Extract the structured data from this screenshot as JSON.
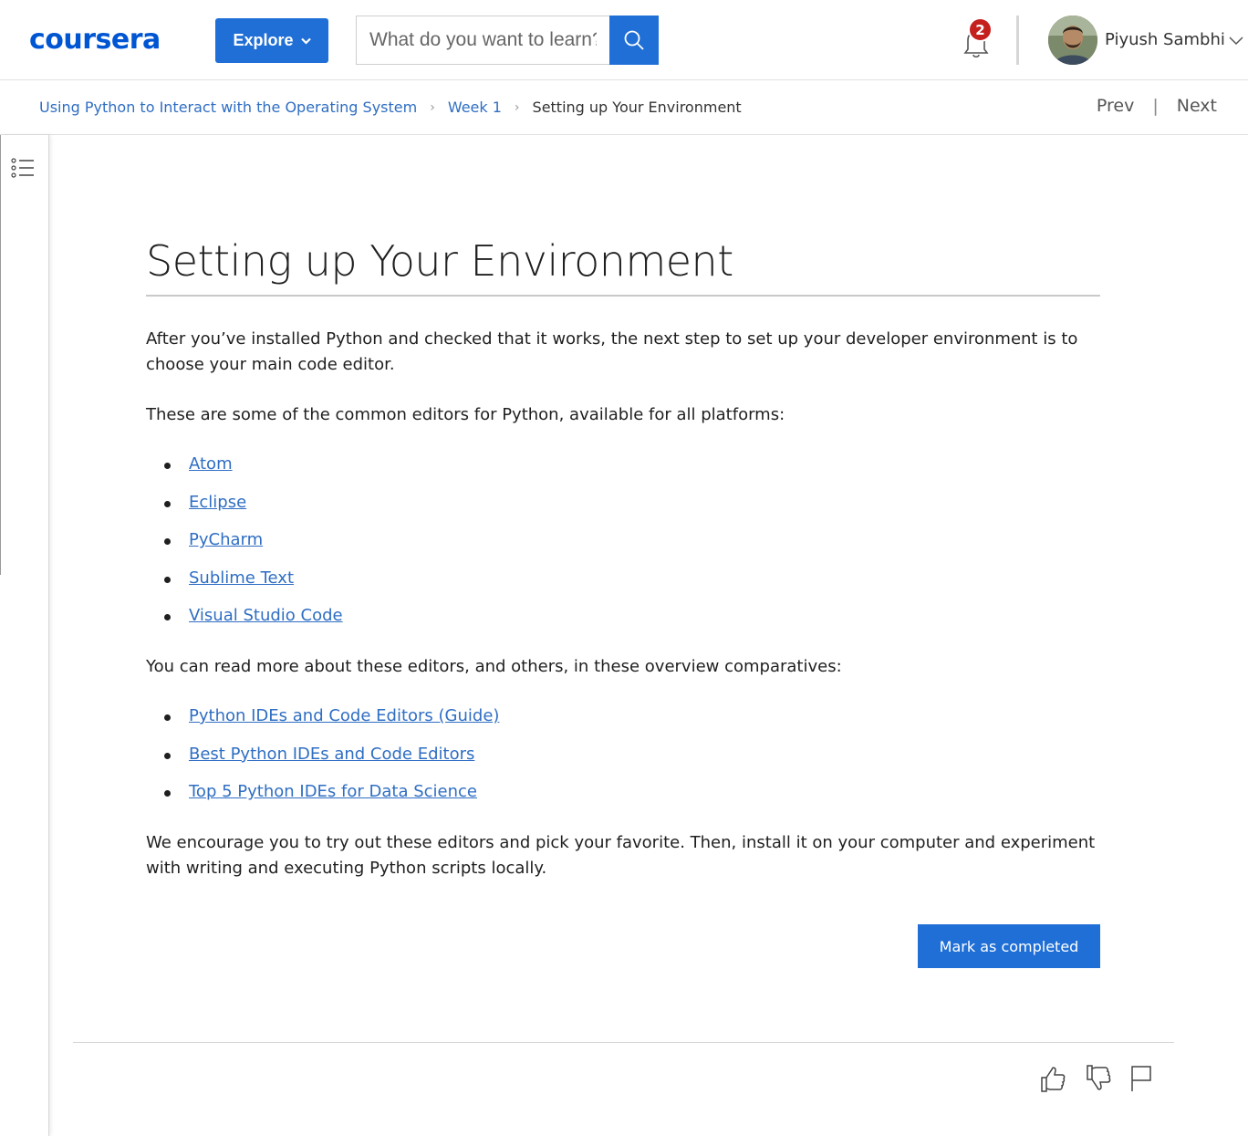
{
  "header": {
    "logo_text": "coursera",
    "explore_label": "Explore",
    "search_placeholder": "What do you want to learn?",
    "notification_count": "2",
    "user_name": "Piyush Sambhi"
  },
  "breadcrumb": {
    "course": "Using Python to Interact with the Operating System",
    "week": "Week 1",
    "current": "Setting up Your Environment"
  },
  "nav": {
    "prev_label": "Prev",
    "next_label": "Next"
  },
  "article": {
    "title": "Setting up Your Environment",
    "intro": "After you’ve installed Python and checked that it works, the next step to set up your developer environment is to choose your main code editor.",
    "editors_intro": "These are some of the common editors for Python, available for all platforms:",
    "editors": [
      "Atom",
      "Eclipse",
      "PyCharm",
      "Sublime Text",
      "Visual Studio Code"
    ],
    "comparatives_intro": "You can read more about these editors, and others, in these overview comparatives:",
    "comparatives": [
      "Python IDEs and Code Editors (Guide)",
      "Best Python IDEs and Code Editors",
      "Top 5 Python IDEs for Data Science"
    ],
    "outro": "We encourage you to try out these editors and pick your favorite. Then, install it on your computer and experiment with writing and executing Python scripts locally.",
    "complete_label": "Mark as completed"
  },
  "icons": {
    "search": "search-icon",
    "bell": "bell-icon",
    "toc": "list-icon",
    "like": "thumbs-up-icon",
    "dislike": "thumbs-down-icon",
    "flag": "flag-icon"
  },
  "colors": {
    "brand": "#0056d2",
    "button": "#1f6fd6",
    "link": "#2f6ec3",
    "badge": "#c4211e"
  }
}
